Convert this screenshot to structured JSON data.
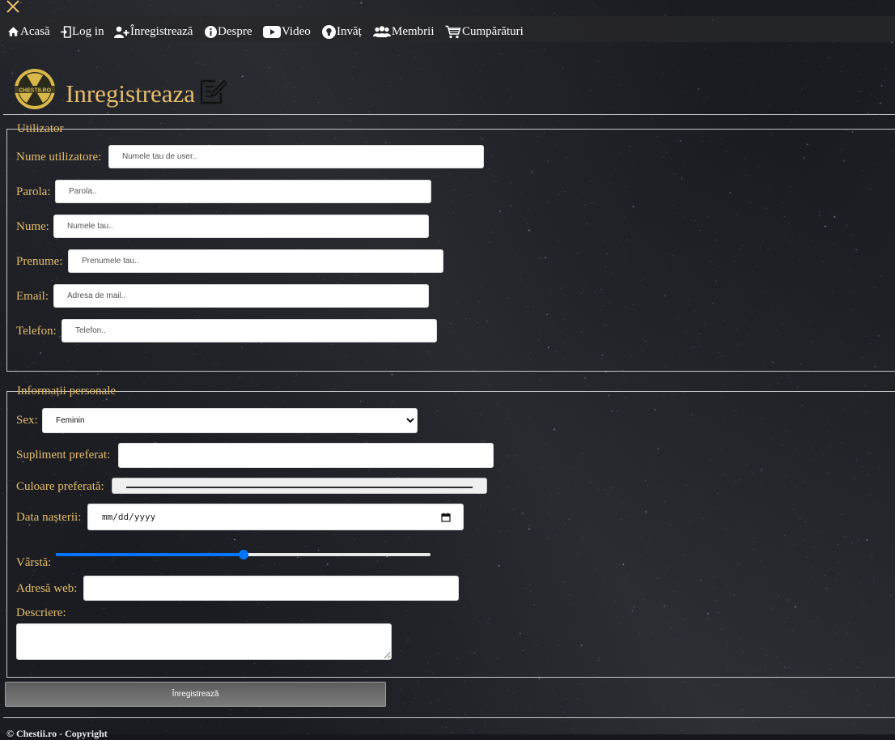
{
  "nav": {
    "items": [
      {
        "label": "Acasă",
        "icon": "home-icon"
      },
      {
        "label": "Log in",
        "icon": "login-icon"
      },
      {
        "label": "Înregistrează",
        "icon": "add-user-icon"
      },
      {
        "label": "Despre",
        "icon": "info-icon"
      },
      {
        "label": "Video",
        "icon": "youtube-icon"
      },
      {
        "label": "Invăț",
        "icon": "lightbulb-icon"
      },
      {
        "label": "Membrii",
        "icon": "users-icon"
      },
      {
        "label": "Cumpărături",
        "icon": "cart-icon"
      }
    ]
  },
  "header": {
    "title": "Inregistreaza",
    "logo_text": "CHESTII.RO"
  },
  "user_section": {
    "legend": "Utilizator",
    "username_label": "Nume utilizatore:",
    "username_placeholder": "Numele tau de user..",
    "password_label": "Parola:",
    "password_placeholder": "Parola..",
    "lastname_label": "Nume:",
    "lastname_placeholder": "Numele tau..",
    "firstname_label": "Prenume:",
    "firstname_placeholder": "Prenumele tau..",
    "email_label": "Email:",
    "email_placeholder": "Adresa de mail..",
    "phone_label": "Telefon:",
    "phone_placeholder": "Telefon.."
  },
  "personal_section": {
    "legend": "Informații personale",
    "sex_label": "Sex:",
    "sex_value": "Feminin",
    "supplement_label": "Supliment preferat:",
    "color_label": "Culoare preferată:",
    "color_value": "#2b2b2b",
    "birthdate_label": "Data nașterii:",
    "birthdate_placeholder": "mm/dd/yyyy",
    "age_label": "Vârstă:",
    "age_slider_fraction": 0.5,
    "website_label": "Adresă web:",
    "description_label": "Descriere:"
  },
  "submit_label": "Înregistrează",
  "footer": {
    "text": "© Chestii.ro - Copyright"
  },
  "colors": {
    "accent": "#e6bd6a",
    "slider": "#0075ff",
    "navbar": "#2a2a2c"
  }
}
